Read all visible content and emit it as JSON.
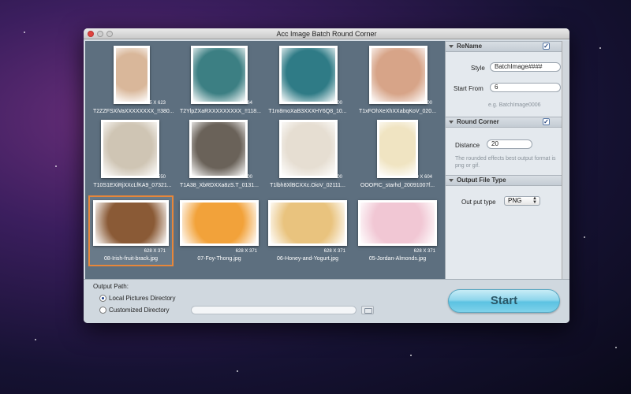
{
  "window": {
    "title": "Acc Image Batch Round Corner"
  },
  "gallery": {
    "items": [
      {
        "name": "T2ZZFSXiVaXXXXXXXX_!!380...",
        "dims": "465 X 623",
        "color": "#d9b79a"
      },
      {
        "name": "T2YlpZXaRXXXXXXXXX_!!118...",
        "dims": "X 564",
        "color": "#3c7f83"
      },
      {
        "name": "T1m8moXaB3XXXHY6Q8_10...",
        "dims": "X 600",
        "color": "#2f7b86"
      },
      {
        "name": "T1xFOhXeXhXXabqKoV_020...",
        "dims": "X 500",
        "color": "#d7a488"
      },
      {
        "name": "T10S1EXiRjXXcLfKA9_07321...",
        "dims": "X 550",
        "color": "#cfc5b4"
      },
      {
        "name": "T1A38_XbRDXXa8zS.T_0131...",
        "dims": "X 600",
        "color": "#6a6259"
      },
      {
        "name": "T1lbh8XlBCXXc.OioV_02111...",
        "dims": "X 600",
        "color": "#e6ded2"
      },
      {
        "name": "OOOPIC_starhd_20091007f...",
        "dims": "429 X 604",
        "color": "#f0e4c2"
      },
      {
        "name": "08-Irish-fruit-brack.jpg",
        "dims": "628 X 371",
        "color": "#8a5a36"
      },
      {
        "name": "07-Foy-Thong.jpg",
        "dims": "628 X 371",
        "color": "#f2a23a"
      },
      {
        "name": "06-Honey-and-Yogurt.jpg",
        "dims": "628 X 371",
        "color": "#e9c37e"
      },
      {
        "name": "05-Jordan-Almonds.jpg",
        "dims": "628 X 371",
        "color": "#f1c7d4"
      }
    ]
  },
  "sidebar": {
    "rename": {
      "header": "ReName",
      "checked": "✓",
      "style_label": "Style",
      "style_value": "BatchImage####",
      "start_from_label": "Start From",
      "start_from_value": "6",
      "example": "e.g. BatchImage0006"
    },
    "round_corner": {
      "header": "Round Corner",
      "checked": "✓",
      "distance_label": "Distance",
      "distance_value": "20",
      "note": "The rounded effects best output format is png or gif."
    },
    "output_type": {
      "header": "Output File Type",
      "type_label": "Out put type",
      "type_value": "PNG"
    }
  },
  "bottom": {
    "output_path_label": "Output Path:",
    "option_local": "Local Pictures Directory",
    "option_custom": "Customized Directory",
    "start_label": "Start"
  },
  "colors": {
    "accent": "#5cc2e2",
    "selection": "#e8873a"
  }
}
